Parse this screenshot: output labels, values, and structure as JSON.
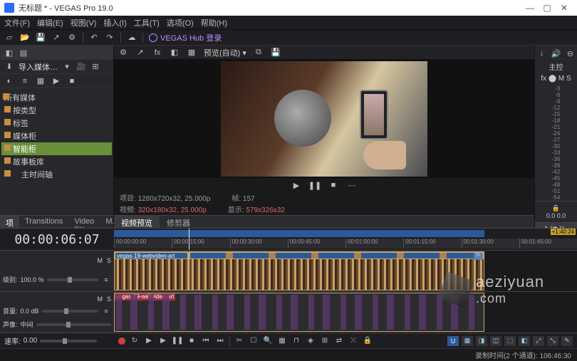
{
  "titlebar": {
    "title": "无标题 * - VEGAS Pro 19.0"
  },
  "menu": [
    "文件(F)",
    "编辑(E)",
    "视图(V)",
    "插入(I)",
    "工具(T)",
    "选项(O)",
    "帮助(H)"
  ],
  "hub": "VEGAS Hub 登录",
  "left": {
    "import": "导入媒体…",
    "tree": [
      "所有媒体",
      "按类型",
      "标签",
      "媒体柜",
      "智能柜",
      "故事板库",
      "主时间轴"
    ],
    "selected_index": 4,
    "tabs": [
      "项目媒体",
      "Transitions",
      "Video FX",
      "M..."
    ],
    "active_tab": 0
  },
  "preview": {
    "dropdown": "预览(自动) ▾",
    "info": {
      "project_label": "项目:",
      "project_value": "1280x720x32, 25.000p",
      "video_label": "视频:",
      "video_value": "320x180x32, 25.000p",
      "frame_label": "帧:",
      "frame_value": "157",
      "display_label": "显示:",
      "display_value": "579x326x32"
    },
    "tabs": [
      "视频预览",
      "修剪器"
    ],
    "active_tab": 0
  },
  "right": {
    "label": "主控",
    "fx_row": "fx ⬤  M  S",
    "scale": [
      "-3",
      "-6",
      "-9",
      "-12",
      "-15",
      "-18",
      "-21",
      "-24",
      "-27",
      "-30",
      "-33",
      "-36",
      "-39",
      "-42",
      "-45",
      "-48",
      "-51",
      "-54"
    ],
    "bottom_values": "0.0    0.0",
    "tab": "主控总线"
  },
  "timeline": {
    "timecode": "00:00:06:07",
    "ruler": [
      "00:00:00:00",
      "00:00:15:00",
      "00:00:30:00",
      "00:00:45:00",
      "00:01:00:00",
      "00:01:15:00",
      "00:01:30:00",
      "00:01:45:00"
    ],
    "end_badge": "+1:40:24",
    "tracks": [
      {
        "name_label": "级别:",
        "name_value": "100.0 %",
        "m": "M",
        "s": "S",
        "clip_label": "vegas-19-webvideo-art"
      },
      {
        "name_label": "音量:",
        "name_value": "0.0 dB",
        "pan_label": "声像:",
        "pan_value": "中间",
        "m": "M",
        "s": "S",
        "clip_label": "vegas-19-webvideo-art"
      }
    ]
  },
  "bottom": {
    "rate_label": "速率:",
    "rate_value": "0.00",
    "tool_letters": [
      "U",
      "▦",
      "◨",
      "◫",
      "⬚",
      "◧",
      "⤢",
      "⤡",
      "✎"
    ]
  },
  "status": "录制时间(2 个通道): 106:46:30",
  "watermark": "aeziyuan\n.com"
}
